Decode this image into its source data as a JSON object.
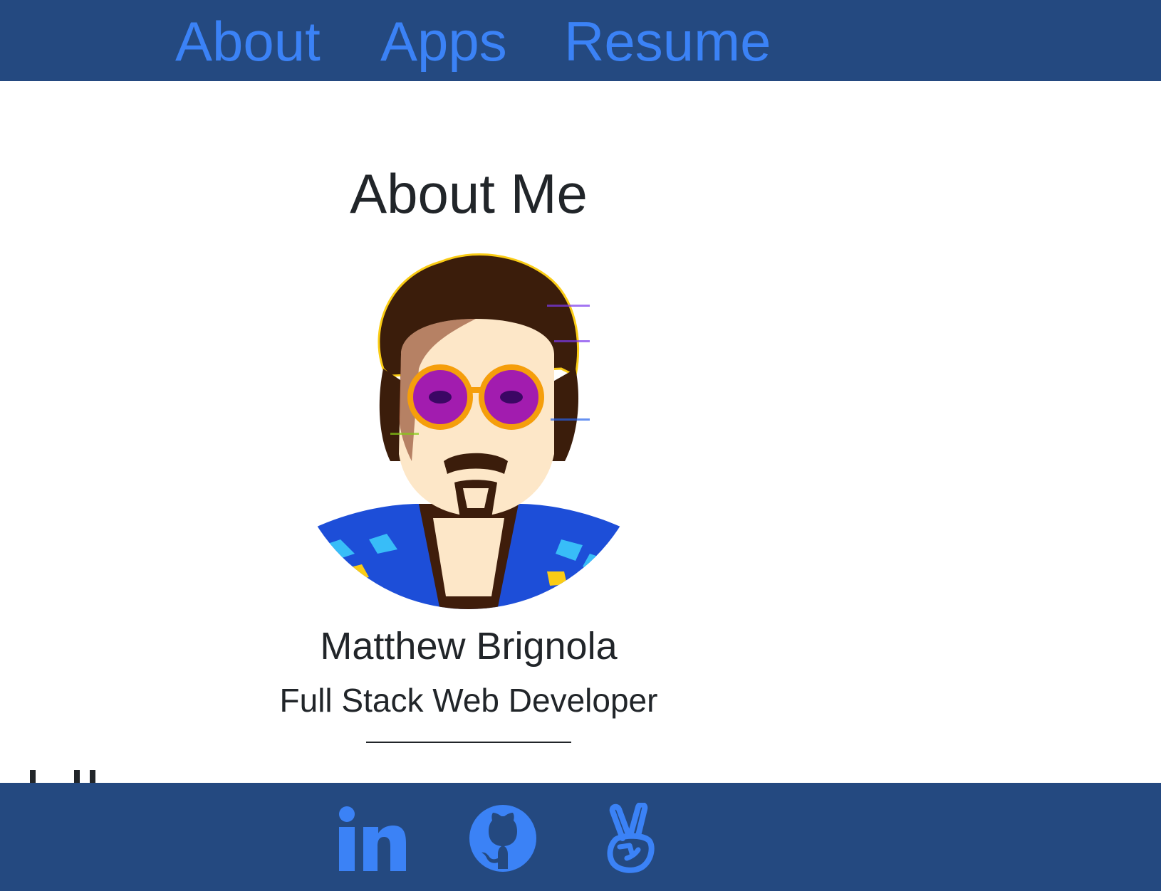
{
  "nav": {
    "items": [
      {
        "label": "About"
      },
      {
        "label": "Apps"
      },
      {
        "label": "Resume"
      }
    ]
  },
  "main": {
    "title": "About Me",
    "name": "Matthew Brignola",
    "role": "Full Stack Web Developer",
    "avatar_icon": "profile-portrait-glitch"
  },
  "footer": {
    "social": [
      {
        "icon": "linkedin-icon"
      },
      {
        "icon": "github-icon"
      },
      {
        "icon": "angellist-icon"
      }
    ]
  },
  "colors": {
    "nav_bg": "#244980",
    "link": "#3b82f6",
    "text": "#212529",
    "page_bg": "#ffffff"
  }
}
